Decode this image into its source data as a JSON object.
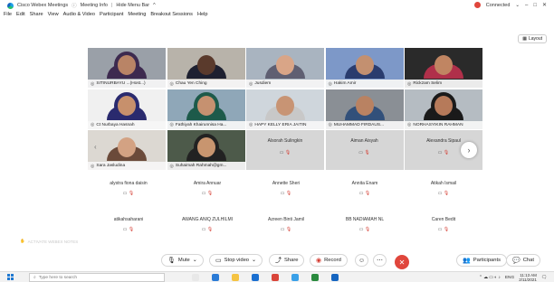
{
  "titlebar": {
    "app_name": "Cisco Webex Meetings",
    "meeting_info": "Meeting Info",
    "hide_menu": "Hide Menu Bar",
    "connection": "Connected"
  },
  "menu": [
    "File",
    "Edit",
    "Share",
    "View",
    "Audio & Video",
    "Participant",
    "Meeting",
    "Breakout Sessions",
    "Help"
  ],
  "layout_label": "Layout",
  "video_tiles": [
    {
      "name": "SITINURBAYU ...(Host...)",
      "scene": "#9aa0a8",
      "face": "#b98466",
      "body": "#3d2a4f",
      "hijab": true
    },
    {
      "name": "Chau Yen Ching",
      "scene": "#b8b3aa",
      "face": "#5a3a2c",
      "body": "#1e2030",
      "hijab": false
    },
    {
      "name": "Jusdiem",
      "scene": "#a9b4c0",
      "face": "#d9a587",
      "body": "#5f5f72",
      "hijab": false
    },
    {
      "name": "Hakim Amir",
      "scene": "#7d98c8",
      "face": "#c39070",
      "body": "#2a3c6e",
      "hijab": false
    },
    {
      "name": "Rickzam Selim",
      "scene": "#2a2a2a",
      "face": "#c08562",
      "body": "#b0304a",
      "hijab": false
    },
    {
      "name": "Ct Nurbaya Hasnah",
      "scene": "#f0f0f0",
      "face": "#c7906c",
      "body": "#2a2a6e",
      "hijab": true
    },
    {
      "name": "Fathiyah Khairunnisa Ha...",
      "scene": "#8fa7b8",
      "face": "#c69170",
      "body": "#1d5a4a",
      "hijab": true
    },
    {
      "name": "HAPY KELLY ERIA JAITIN",
      "scene": "#cfd6dc",
      "face": "#c89474",
      "body": "#c8c8c8",
      "hijab": false
    },
    {
      "name": "MUHAMMAD FIRDAUS...",
      "scene": "#8a8f95",
      "face": "#b98262",
      "body": "#32507a",
      "hijab": false
    },
    {
      "name": "NORHASYIKIN RAHMAN",
      "scene": "#b5bcc2",
      "face": "#b67a5a",
      "body": "#1a1a1a",
      "hijab": true
    },
    {
      "name": "Sara Jasludina",
      "scene": "#dcd8d2",
      "face": "#d3a283",
      "body": "#6b4a3a",
      "hijab": false
    },
    {
      "name": "Suhaimah Rahmah@gm...",
      "scene": "#4d5a4a",
      "face": "#c8956f",
      "body": "#222222",
      "hijab": true
    }
  ],
  "grey_tiles": [
    "Alsorah Sulingkin",
    "Aiman Aisyah",
    "Alexandra Sipaul"
  ],
  "name_rows": [
    [
      "alystra fiona daisin",
      "Amira Annuar",
      "Annette Sheri",
      "Annita Enam",
      "Atikah Ismail"
    ],
    [
      "atikahsaharani",
      "AWANG ANIQ ZULHILMI",
      "Azreen Binti Jamil",
      "BB NADIAMAH NL",
      "Caren Bedit"
    ]
  ],
  "watermark": "ACTIVATE WEBEX NOTES",
  "controls": {
    "mute": "Mute",
    "stop_video": "Stop video",
    "share": "Share",
    "record": "Record",
    "participants": "Participants",
    "chat": "Chat"
  },
  "taskbar": {
    "search_placeholder": "Type here to search",
    "time": "11:13 AM",
    "date": "2/11/2021",
    "lang": "ENG"
  }
}
